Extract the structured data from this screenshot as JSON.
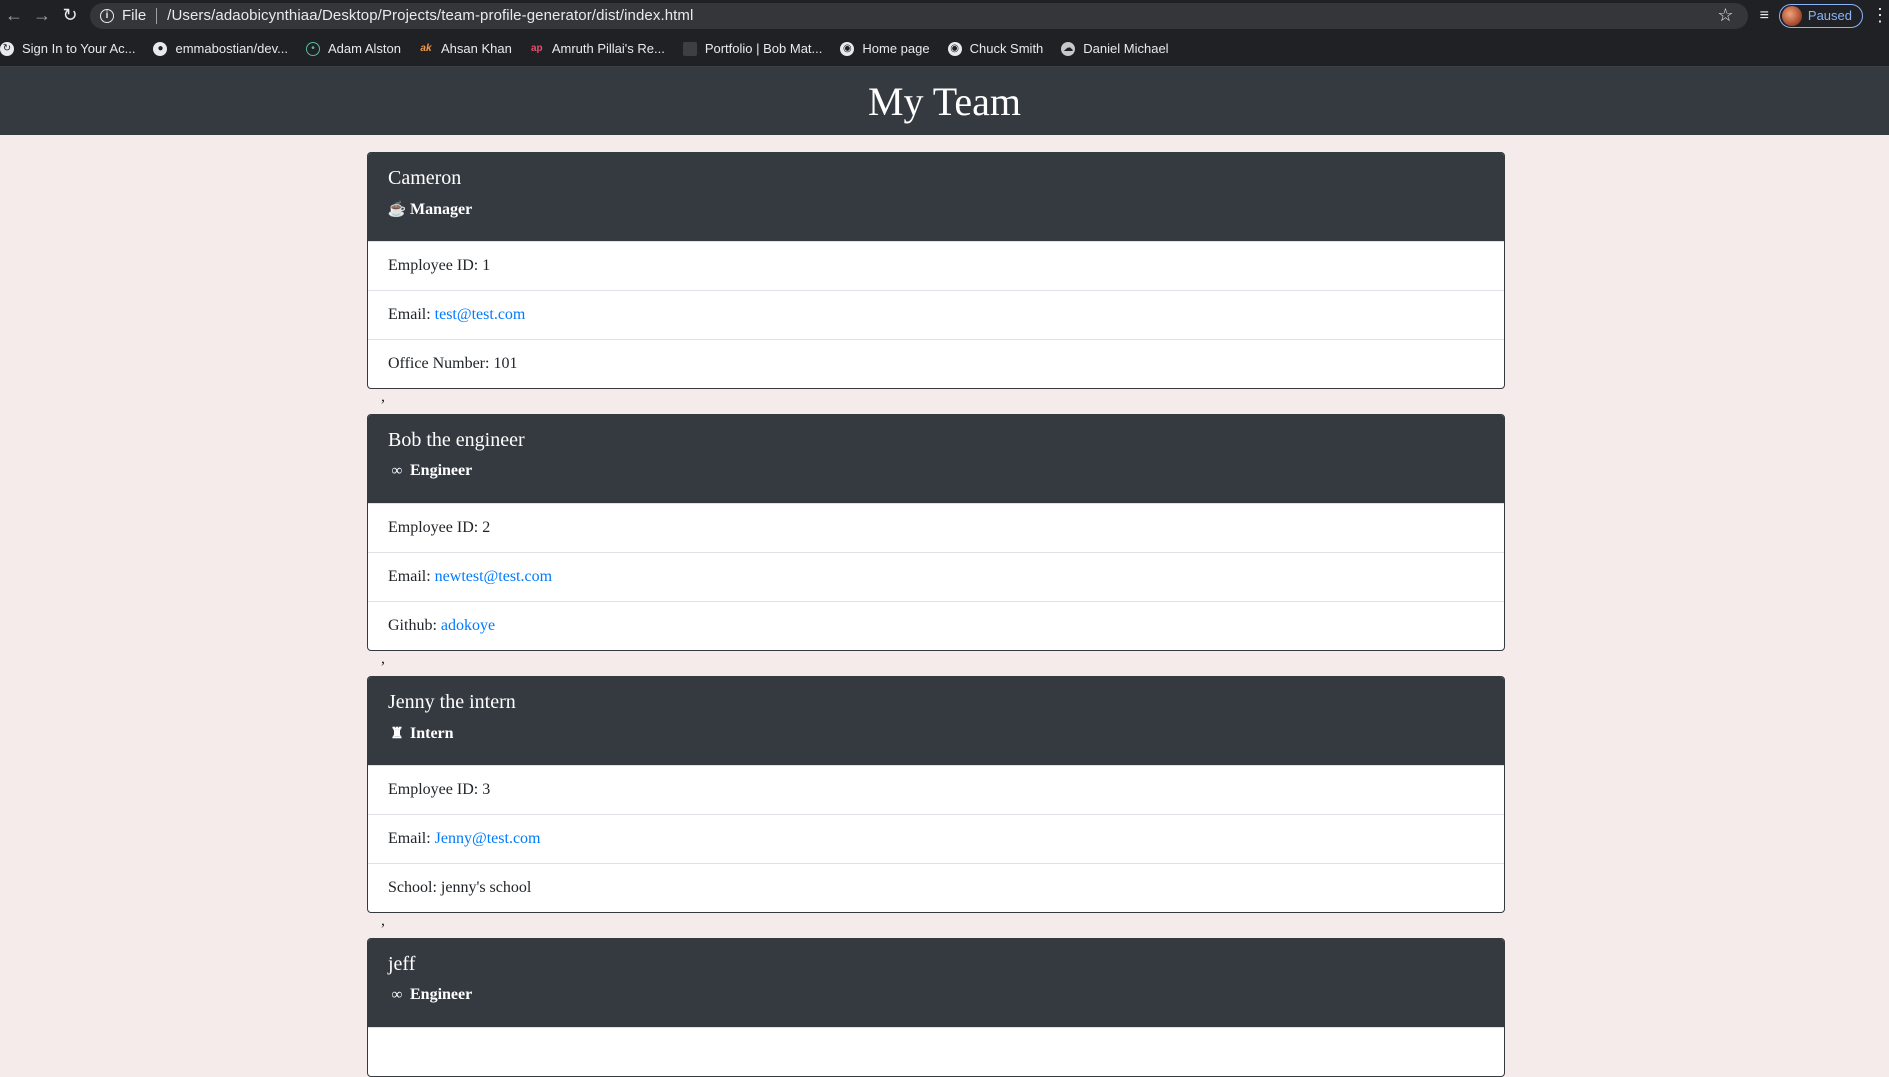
{
  "browser": {
    "file_label": "File",
    "url": "/Users/adaobicynthiaa/Desktop/Projects/team-profile-generator/dist/index.html",
    "profile_status": "Paused",
    "bookmarks": [
      {
        "label": "Sign In to Your Ac...",
        "icon": "refresh-circle-icon"
      },
      {
        "label": "emmabostian/dev...",
        "icon": "github-icon"
      },
      {
        "label": "Adam Alston",
        "icon": "atom-icon"
      },
      {
        "label": "Ahsan Khan",
        "icon": "ak-logo-icon"
      },
      {
        "label": "Amruth Pillai's Re...",
        "icon": "ap-logo-icon"
      },
      {
        "label": "Portfolio | Bob Mat...",
        "icon": "page-icon"
      },
      {
        "label": "Home page",
        "icon": "globe-icon"
      },
      {
        "label": "Chuck Smith",
        "icon": "globe-icon"
      },
      {
        "label": "Daniel Michael",
        "icon": "cloud-icon"
      }
    ]
  },
  "page": {
    "title": "My Team",
    "separator": ","
  },
  "employees": [
    {
      "name": "Cameron",
      "role": "Manager",
      "role_icon": "mug-icon",
      "id_label": "Employee ID: 1",
      "email_label": "Email:",
      "email": "test@test.com",
      "extra_label": "Office Number: 101",
      "extra_link": ""
    },
    {
      "name": "Bob the engineer",
      "role": "Engineer",
      "role_icon": "glasses-icon",
      "id_label": "Employee ID: 2",
      "email_label": "Email:",
      "email": "newtest@test.com",
      "extra_label": "Github:",
      "extra_link": "adokoye"
    },
    {
      "name": "Jenny the intern",
      "role": "Intern",
      "role_icon": "graduate-icon",
      "id_label": "Employee ID: 3",
      "email_label": "Email:",
      "email": "Jenny@test.com",
      "extra_label": "School: jenny's school",
      "extra_link": ""
    },
    {
      "name": "jeff",
      "role": "Engineer",
      "role_icon": "glasses-icon"
    }
  ]
}
